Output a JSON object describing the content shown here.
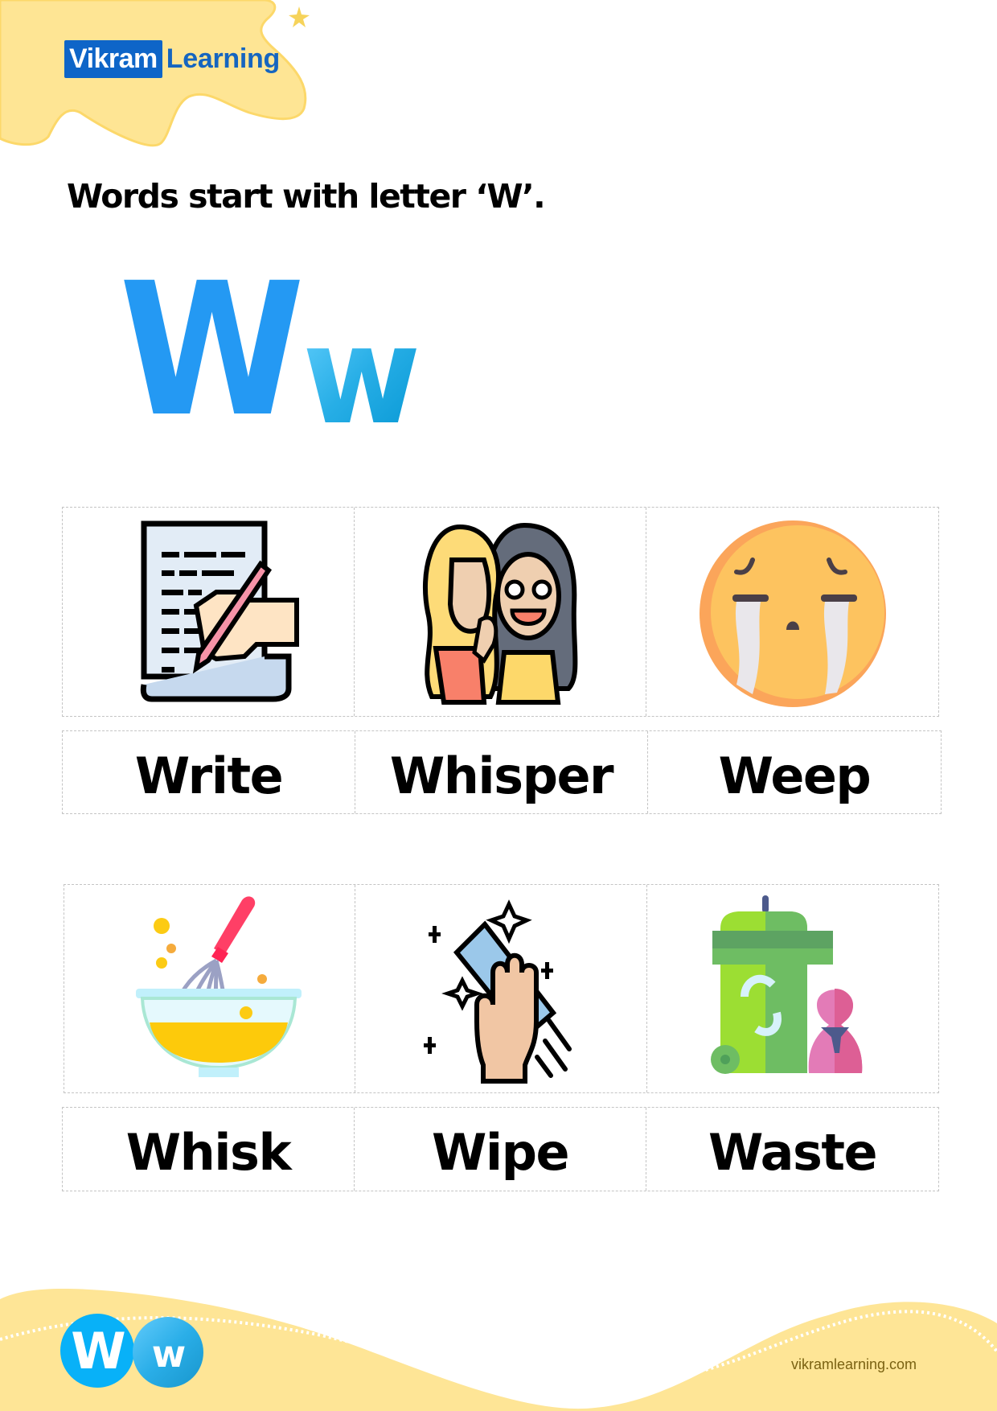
{
  "header": {
    "logo_part1": "Vikram",
    "logo_part2": "Learning",
    "brand_color": "#0e65c8",
    "decoration": "star-icon"
  },
  "page": {
    "title": "Words start with letter ‘W’.",
    "letter_upper": "W",
    "letter_lower": "w"
  },
  "rows": [
    {
      "cards": [
        {
          "word": "Write",
          "icon": "writing-hand-icon"
        },
        {
          "word": "Whisper",
          "icon": "whispering-girls-icon"
        },
        {
          "word": "Weep",
          "icon": "crying-face-icon"
        }
      ]
    },
    {
      "cards": [
        {
          "word": "Whisk",
          "icon": "whisk-bowl-icon"
        },
        {
          "word": "Wipe",
          "icon": "wiping-hand-icon"
        },
        {
          "word": "Waste",
          "icon": "recycle-bin-icon"
        }
      ]
    }
  ],
  "footer": {
    "badge_upper": "W",
    "badge_lower": "w",
    "website": "vikramlearning.com"
  }
}
